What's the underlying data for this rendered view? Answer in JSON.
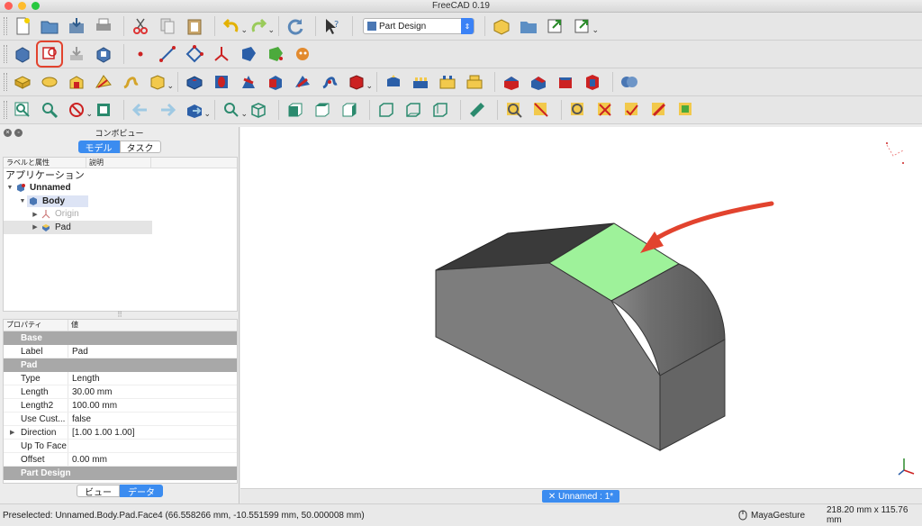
{
  "window": {
    "title": "FreeCAD 0.19"
  },
  "toolbar": {
    "workbench": "Part Design"
  },
  "combo": {
    "title": "コンボビュー",
    "tabs": [
      "モデル",
      "タスク"
    ],
    "tree_columns": [
      "ラベルと属性",
      "説明"
    ],
    "tree": {
      "root": "アプリケーション",
      "doc": "Unnamed",
      "body": "Body",
      "origin": "Origin",
      "pad": "Pad"
    },
    "props_columns": [
      "プロパティ",
      "値"
    ],
    "groups": {
      "base": "Base",
      "pad": "Pad",
      "part_design": "Part Design"
    },
    "props": {
      "label": {
        "k": "Label",
        "v": "Pad"
      },
      "type": {
        "k": "Type",
        "v": "Length"
      },
      "length": {
        "k": "Length",
        "v": "30.00 mm"
      },
      "length2": {
        "k": "Length2",
        "v": "100.00 mm"
      },
      "use_custom": {
        "k": "Use Cust...",
        "v": "false"
      },
      "direction": {
        "k": "Direction",
        "v": "[1.00 1.00 1.00]"
      },
      "up_to_face": {
        "k": "Up To Face",
        "v": ""
      },
      "offset": {
        "k": "Offset",
        "v": "0.00 mm"
      }
    },
    "bottom_tabs": [
      "ビュー",
      "データ"
    ]
  },
  "doc_tab": "✕ Unnamed : 1*",
  "status": {
    "message": "Preselected: Unnamed.Body.Pad.Face4 (66.558266 mm, -10.551599 mm, 50.000008 mm)",
    "nav_style": "MayaGesture",
    "dimensions": "218.20 mm x 115.76 mm"
  },
  "colors": {
    "accent": "#3b8cf0",
    "highlight_face": "#9ef29a",
    "arrow": "#e2432e"
  }
}
